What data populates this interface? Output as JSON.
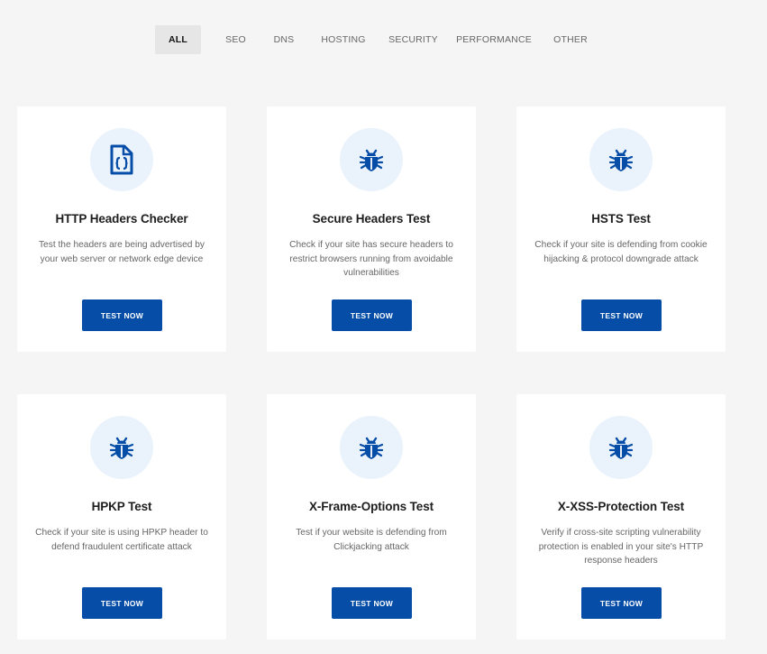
{
  "tabs": [
    {
      "label": "ALL",
      "active": true
    },
    {
      "label": "SEO"
    },
    {
      "label": "DNS"
    },
    {
      "label": "HOSTING"
    },
    {
      "label": "SECURITY"
    },
    {
      "label": "PERFORMANCE"
    },
    {
      "label": "OTHER"
    }
  ],
  "cards": [
    {
      "title": "HTTP Headers Checker",
      "desc": "Test the headers are being advertised by your web server or network edge device",
      "button": "TEST NOW",
      "icon": "code-file-icon"
    },
    {
      "title": "Secure Headers Test",
      "desc": "Check if your site has secure headers to restrict browsers running from avoidable vulnerabilities",
      "button": "TEST NOW",
      "icon": "bug-shield-icon"
    },
    {
      "title": "HSTS Test",
      "desc": "Check if your site is defending from cookie hijacking & protocol downgrade attack",
      "button": "TEST NOW",
      "icon": "bug-shield-icon"
    },
    {
      "title": "HPKP Test",
      "desc": "Check if your site is using HPKP header to defend fraudulent certificate attack",
      "button": "TEST NOW",
      "icon": "bug-shield-icon"
    },
    {
      "title": "X-Frame-Options Test",
      "desc": "Test if your website is defending from Clickjacking attack",
      "button": "TEST NOW",
      "icon": "bug-shield-icon"
    },
    {
      "title": "X-XSS-Protection Test",
      "desc": "Verify if cross-site scripting vulnerability protection is enabled in your site's HTTP response headers",
      "button": "TEST NOW",
      "icon": "bug-shield-icon"
    }
  ],
  "colors": {
    "accent": "#054da7",
    "icon_bg": "#eaf2fc"
  }
}
